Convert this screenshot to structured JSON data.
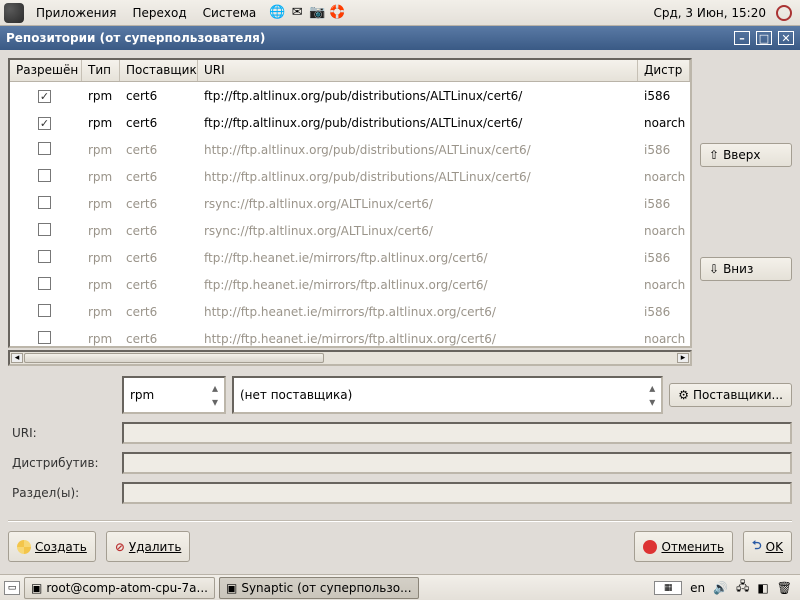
{
  "top_panel": {
    "menus": [
      "Приложения",
      "Переход",
      "Система"
    ],
    "clock": "Срд,  3 Июн, 15:20"
  },
  "window": {
    "title": "Репозитории (от суперпользователя)"
  },
  "table": {
    "headers": {
      "enabled": "Разрешён",
      "type": "Тип",
      "vendor": "Поставщик",
      "uri": "URI",
      "dist": "Дистр"
    },
    "rows": [
      {
        "enabled": true,
        "type": "rpm",
        "vendor": "cert6",
        "uri": "ftp://ftp.altlinux.org/pub/distributions/ALTLinux/cert6/",
        "dist": "i586",
        "active": true
      },
      {
        "enabled": true,
        "type": "rpm",
        "vendor": "cert6",
        "uri": "ftp://ftp.altlinux.org/pub/distributions/ALTLinux/cert6/",
        "dist": "noarch",
        "active": true
      },
      {
        "enabled": false,
        "type": "rpm",
        "vendor": "cert6",
        "uri": "http://ftp.altlinux.org/pub/distributions/ALTLinux/cert6/",
        "dist": "i586",
        "active": false
      },
      {
        "enabled": false,
        "type": "rpm",
        "vendor": "cert6",
        "uri": "http://ftp.altlinux.org/pub/distributions/ALTLinux/cert6/",
        "dist": "noarch",
        "active": false
      },
      {
        "enabled": false,
        "type": "rpm",
        "vendor": "cert6",
        "uri": "rsync://ftp.altlinux.org/ALTLinux/cert6/",
        "dist": "i586",
        "active": false
      },
      {
        "enabled": false,
        "type": "rpm",
        "vendor": "cert6",
        "uri": "rsync://ftp.altlinux.org/ALTLinux/cert6/",
        "dist": "noarch",
        "active": false
      },
      {
        "enabled": false,
        "type": "rpm",
        "vendor": "cert6",
        "uri": "ftp://ftp.heanet.ie/mirrors/ftp.altlinux.org/cert6/",
        "dist": "i586",
        "active": false
      },
      {
        "enabled": false,
        "type": "rpm",
        "vendor": "cert6",
        "uri": "ftp://ftp.heanet.ie/mirrors/ftp.altlinux.org/cert6/",
        "dist": "noarch",
        "active": false
      },
      {
        "enabled": false,
        "type": "rpm",
        "vendor": "cert6",
        "uri": "http://ftp.heanet.ie/mirrors/ftp.altlinux.org/cert6/",
        "dist": "i586",
        "active": false
      },
      {
        "enabled": false,
        "type": "rpm",
        "vendor": "cert6",
        "uri": "http://ftp.heanet.ie/mirrors/ftp.altlinux.org/cert6/",
        "dist": "noarch",
        "active": false
      }
    ]
  },
  "side_buttons": {
    "up": "Вверх",
    "down": "Вниз"
  },
  "form": {
    "type_value": "rpm",
    "vendor_value": "(нет поставщика)",
    "vendors_button": "Поставщики...",
    "uri_label": "URI:",
    "dist_label": "Дистрибутив:",
    "sections_label": "Раздел(ы):"
  },
  "buttons": {
    "new": "Создать",
    "delete": "Удалить",
    "cancel": "Отменить",
    "ok": "OK"
  },
  "taskbar": {
    "lang": "en",
    "tasks": [
      {
        "label": "root@comp-atom-cpu-7a...",
        "active": false
      },
      {
        "label": "Synaptic (от суперпользо...",
        "active": true
      }
    ]
  }
}
